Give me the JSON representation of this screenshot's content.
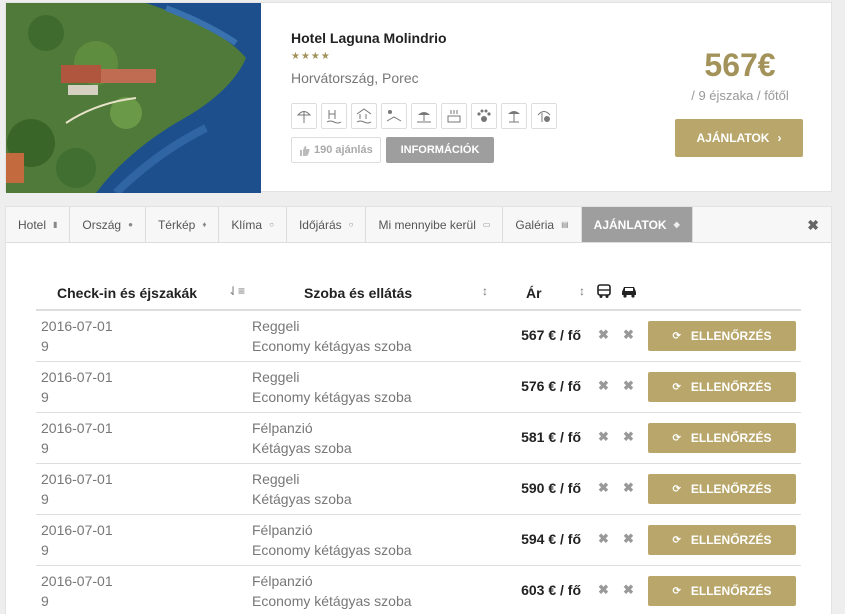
{
  "hotel": {
    "name": "Hotel Laguna Molindrio",
    "stars": "★★★★",
    "location": "Horvátország, Porec",
    "amenities": [
      "beach-umbrella-icon",
      "pool-icon",
      "indoor-pool-icon",
      "sunbed-icon",
      "beach-icon",
      "sauna-icon",
      "pets-icon",
      "sunshade-icon",
      "wellness-icon"
    ],
    "likes": "190 ajánlás",
    "info_button": "INFORMÁCIÓK",
    "price": "567€",
    "price_note": "/ 9 éjszaka / főtől",
    "offers_button": "AJÁNLATOK",
    "offers_arrow": "›"
  },
  "tabs": [
    {
      "label": "Hotel",
      "icon": "▮"
    },
    {
      "label": "Ország",
      "icon": "●"
    },
    {
      "label": "Térkép",
      "icon": "♦"
    },
    {
      "label": "Klíma",
      "icon": "○"
    },
    {
      "label": "Időjárás",
      "icon": "○"
    },
    {
      "label": "Mi mennyibe kerül",
      "icon": "▭"
    },
    {
      "label": "Galéria",
      "icon": "▤"
    },
    {
      "label": "AJÁNLATOK",
      "icon": "◆"
    }
  ],
  "close_symbol": "✖",
  "table": {
    "headers": {
      "checkin": "Check-in és éjszakák",
      "room": "Szoba és ellátás",
      "price": "Ár",
      "sort_checkin": "⇃≡",
      "sort_room": "↕",
      "sort_price": "↕"
    },
    "button_label": "ELLENŐRZÉS",
    "button_icon": "⟳",
    "x_symbol": "✖",
    "rows": [
      {
        "date": "2016-07-01",
        "nights": "9",
        "board": "Reggeli",
        "room": "Economy kétágyas szoba",
        "price": "567 € / fő"
      },
      {
        "date": "2016-07-01",
        "nights": "9",
        "board": "Reggeli",
        "room": "Economy kétágyas szoba",
        "price": "576 € / fő"
      },
      {
        "date": "2016-07-01",
        "nights": "9",
        "board": "Félpanzió",
        "room": "Kétágyas szoba",
        "price": "581 € / fő"
      },
      {
        "date": "2016-07-01",
        "nights": "9",
        "board": "Reggeli",
        "room": "Kétágyas szoba",
        "price": "590 € / fő"
      },
      {
        "date": "2016-07-01",
        "nights": "9",
        "board": "Félpanzió",
        "room": "Economy kétágyas szoba",
        "price": "594 € / fő"
      },
      {
        "date": "2016-07-01",
        "nights": "9",
        "board": "Félpanzió",
        "room": "Economy kétágyas szoba",
        "price": "603 € / fő"
      }
    ]
  },
  "colors": {
    "gold": "#b8a66a",
    "gold_text": "#a3935a",
    "grey_button": "#9e9e9e"
  }
}
